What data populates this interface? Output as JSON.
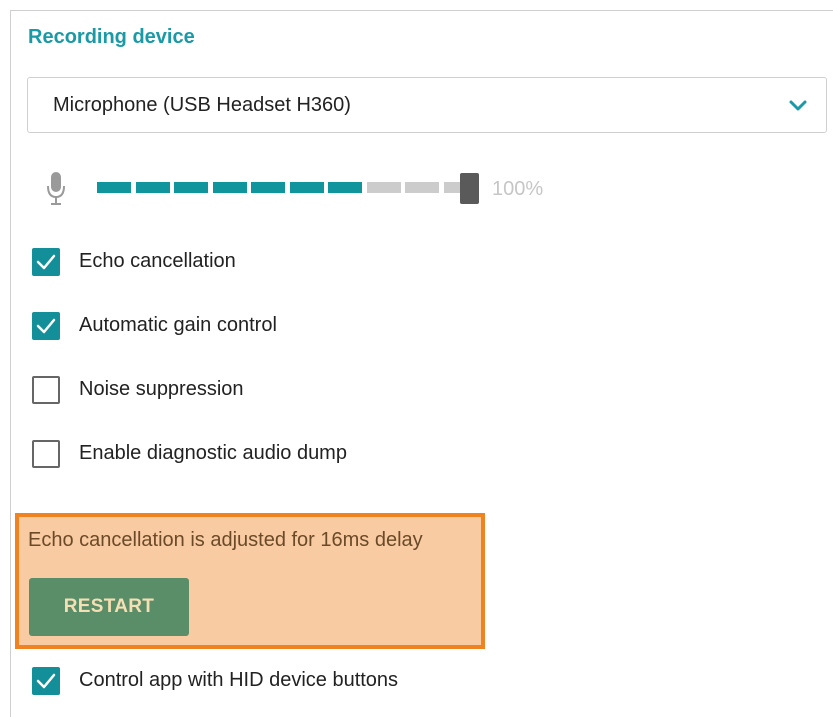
{
  "section": {
    "title": "Recording device"
  },
  "device_select": {
    "value": "Microphone (USB Headset H360)",
    "icon": "chevron-down-icon"
  },
  "level": {
    "value_percent": 100,
    "label": "100%",
    "segments_total": 10,
    "segments_lit": 7
  },
  "options": [
    {
      "label": "Echo cancellation",
      "checked": true
    },
    {
      "label": "Automatic gain control",
      "checked": true
    },
    {
      "label": "Noise suppression",
      "checked": false
    },
    {
      "label": "Enable diagnostic audio dump",
      "checked": false
    }
  ],
  "notice": {
    "message": "Echo cancellation is adjusted for 16ms delay",
    "button_label": "RESTART"
  },
  "hid_option": {
    "label": "Control app with HID device buttons",
    "checked": true
  },
  "colors": {
    "accent": "#1a9aa6",
    "checkbox": "#138f9a",
    "meter_on": "#11959d",
    "meter_off": "#cccccc",
    "notice_bg": "#f9cba3",
    "notice_border": "#f0821f",
    "button": "#5a8e69"
  }
}
